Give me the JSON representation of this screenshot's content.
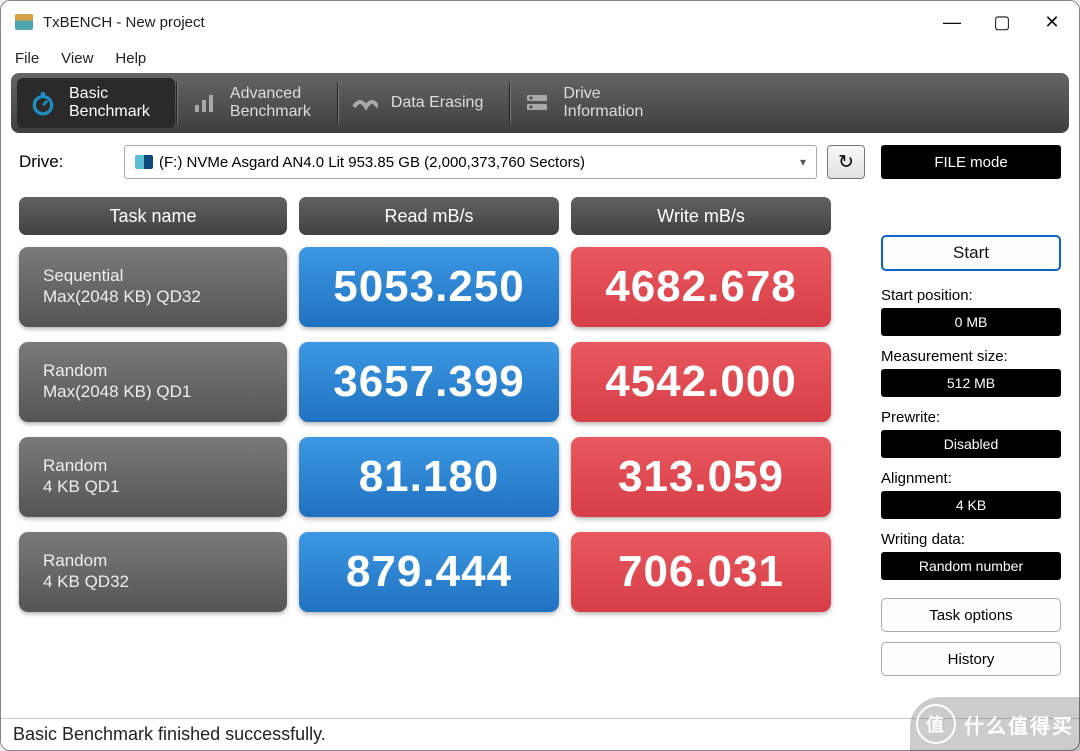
{
  "titlebar": {
    "title": "TxBENCH - New project"
  },
  "menu": {
    "file": "File",
    "view": "View",
    "help": "Help"
  },
  "nav": {
    "basic": "Basic\nBenchmark",
    "advanced": "Advanced\nBenchmark",
    "erasing": "Data Erasing",
    "drive_info": "Drive\nInformation"
  },
  "drive": {
    "label": "Drive:",
    "value": "(F:) NVMe Asgard AN4.0 Lit  953.85 GB (2,000,373,760 Sectors)"
  },
  "file_mode": "FILE mode",
  "headers": {
    "task": "Task name",
    "read": "Read mB/s",
    "write": "Write mB/s"
  },
  "rows": [
    {
      "name1": "Sequential",
      "name2": "Max(2048 KB) QD32",
      "read": "5053.250",
      "write": "4682.678"
    },
    {
      "name1": "Random",
      "name2": "Max(2048 KB) QD1",
      "read": "3657.399",
      "write": "4542.000"
    },
    {
      "name1": "Random",
      "name2": "4 KB QD1",
      "read": "81.180",
      "write": "313.059"
    },
    {
      "name1": "Random",
      "name2": "4 KB QD32",
      "read": "879.444",
      "write": "706.031"
    }
  ],
  "side": {
    "start": "Start",
    "start_pos_lbl": "Start position:",
    "start_pos": "0 MB",
    "meas_lbl": "Measurement size:",
    "meas": "512 MB",
    "prewrite_lbl": "Prewrite:",
    "prewrite": "Disabled",
    "align_lbl": "Alignment:",
    "align": "4 KB",
    "wdata_lbl": "Writing data:",
    "wdata": "Random number",
    "task_opts": "Task options",
    "history": "History"
  },
  "status": "Basic Benchmark finished successfully.",
  "watermark": "什么值得买",
  "watermark_badge": "值"
}
